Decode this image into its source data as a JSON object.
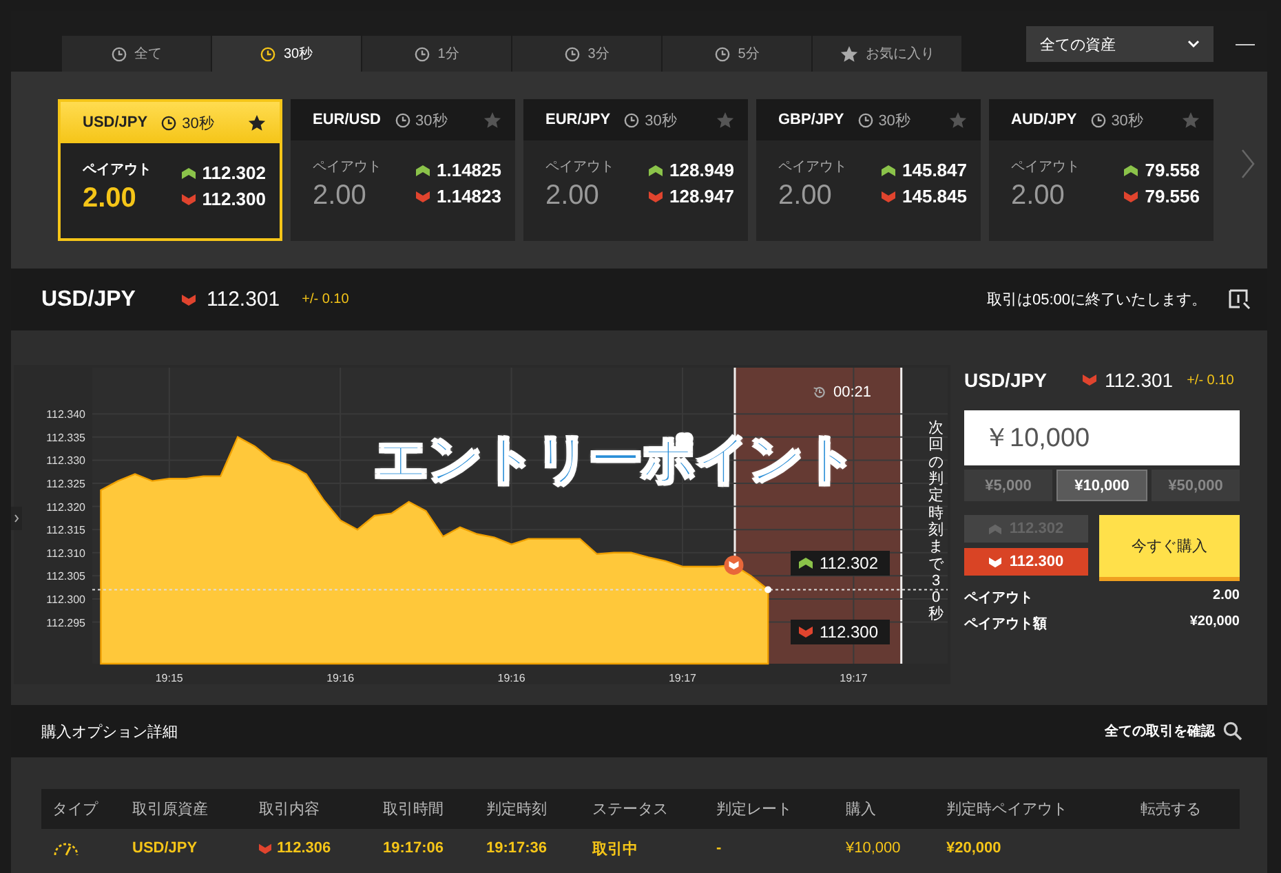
{
  "tabs": [
    {
      "label": "全て",
      "kind": "duration",
      "selected": false
    },
    {
      "label": "30秒",
      "kind": "duration",
      "selected": true
    },
    {
      "label": "1分",
      "kind": "duration",
      "selected": false
    },
    {
      "label": "3分",
      "kind": "duration",
      "selected": false
    },
    {
      "label": "5分",
      "kind": "duration",
      "selected": false
    },
    {
      "label": "お気に入り",
      "kind": "favorites",
      "selected": false
    }
  ],
  "asset_filter": {
    "value": "全ての資産"
  },
  "quote_cards": [
    {
      "pair": "USD/JPY",
      "duration": "30秒",
      "payout_label": "ペイアウト",
      "payout": "2.00",
      "ask": "112.302",
      "bid": "112.300",
      "selected": true
    },
    {
      "pair": "EUR/USD",
      "duration": "30秒",
      "payout_label": "ペイアウト",
      "payout": "2.00",
      "ask": "1.14825",
      "bid": "1.14823",
      "selected": false
    },
    {
      "pair": "EUR/JPY",
      "duration": "30秒",
      "payout_label": "ペイアウト",
      "payout": "2.00",
      "ask": "128.949",
      "bid": "128.947",
      "selected": false
    },
    {
      "pair": "GBP/JPY",
      "duration": "30秒",
      "payout_label": "ペイアウト",
      "payout": "2.00",
      "ask": "145.847",
      "bid": "145.845",
      "selected": false
    },
    {
      "pair": "AUD/JPY",
      "duration": "30秒",
      "payout_label": "ペイアウト",
      "payout": "2.00",
      "ask": "79.558",
      "bid": "79.556",
      "selected": false
    }
  ],
  "instrument_bar": {
    "pair": "USD/JPY",
    "price": "112.301",
    "spread": "+/- 0.10",
    "notice": "取引は05:00に終了いたします。"
  },
  "chart": {
    "timer": "00:21",
    "side_label": "次回の判定時刻まで30秒",
    "ask_tag": "112.302",
    "bid_tag": "112.300",
    "chart_data": {
      "type": "area",
      "grid": true,
      "ylim": [
        112.286,
        112.35
      ],
      "ref_lines": [
        {
          "axis": "y",
          "value": 112.302
        }
      ],
      "categories": [
        null,
        null,
        null,
        null,
        "19:15",
        null,
        null,
        null,
        null,
        null,
        null,
        null,
        null,
        null,
        "19:16",
        null,
        null,
        null,
        null,
        null,
        null,
        null,
        null,
        null,
        "19:16",
        null,
        null,
        null,
        null,
        null,
        null,
        null,
        null,
        null,
        "19:17",
        null,
        null,
        null,
        null,
        null,
        null,
        null,
        null,
        null,
        "19:17",
        null,
        null,
        null,
        null,
        null
      ],
      "series": [
        {
          "color": "#ffc83a",
          "values": [
            112.3235,
            112.3255,
            112.327,
            112.3255,
            112.326,
            112.326,
            112.3265,
            112.3265,
            112.335,
            112.333,
            112.33,
            112.329,
            112.327,
            112.3215,
            112.317,
            112.315,
            112.318,
            112.3185,
            112.321,
            112.319,
            112.3135,
            112.3155,
            112.314,
            112.3133,
            112.3118,
            112.313,
            112.313,
            112.313,
            112.313,
            112.3097,
            112.31,
            112.31,
            112.309,
            112.3082,
            112.307,
            112.307,
            112.307,
            112.3073,
            112.305,
            112.302,
            null,
            null,
            null,
            null,
            null,
            null,
            null,
            null,
            null,
            null
          ]
        }
      ],
      "yticks": [
        {
          "value": 112.295,
          "label": "112.295"
        },
        {
          "value": 112.3,
          "label": "112.300"
        },
        {
          "value": 112.305,
          "label": "112.305"
        },
        {
          "value": 112.31,
          "label": "112.310"
        },
        {
          "value": 112.315,
          "label": "112.315"
        },
        {
          "value": 112.32,
          "label": "112.320"
        },
        {
          "value": 112.325,
          "label": "112.325"
        },
        {
          "value": 112.33,
          "label": "112.330"
        },
        {
          "value": 112.335,
          "label": "112.335"
        },
        {
          "value": 112.34,
          "label": "112.340"
        }
      ]
    }
  },
  "overlay_caption": "エントリーポイント",
  "order_panel": {
    "pair": "USD/JPY",
    "price": "112.301",
    "spread": "+/- 0.10",
    "amount": "￥10,000",
    "presets": [
      {
        "label": "¥5,000",
        "selected": false
      },
      {
        "label": "¥10,000",
        "selected": true
      },
      {
        "label": "¥50,000",
        "selected": false
      }
    ],
    "up": {
      "price": "112.302",
      "selected": false
    },
    "down": {
      "price": "112.300",
      "selected": true
    },
    "buy_button": "今すぐ購入",
    "payout_label": "ペイアウト",
    "payout": "2.00",
    "payout_amount_label": "ペイアウト額",
    "payout_amount": "¥20,000"
  },
  "options_section": {
    "title": "購入オプション詳細",
    "view_all": "全ての取引を確認"
  },
  "table": {
    "columns": [
      "タイプ",
      "取引原資産",
      "取引内容",
      "取引時間",
      "判定時刻",
      "ステータス",
      "判定レート",
      "購入",
      "判定時ペイアウト",
      "転売する"
    ],
    "rows": [
      {
        "asset": "USD/JPY",
        "content": "112.306",
        "trade_time": "19:17:06",
        "expiry": "19:17:36",
        "status": "取引中",
        "rate": "-",
        "purchase": "¥10,000",
        "payout": "¥20,000"
      }
    ]
  }
}
